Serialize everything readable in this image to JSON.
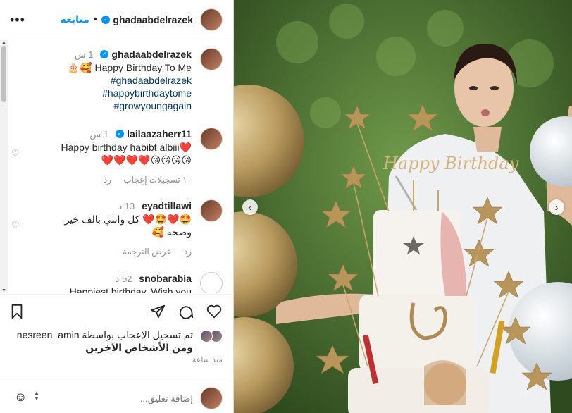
{
  "header": {
    "username": "ghadaabdelrazek",
    "follow": "متابعة",
    "more": "•••"
  },
  "caption": {
    "username": "ghadaabdelrazek",
    "time": "1 س",
    "text": "Happy Birthday To Me",
    "emojis": "🎂🥰",
    "tags": [
      "ghadaabdelrazek#",
      "#happybirthdaytome",
      "#growyoungagain"
    ]
  },
  "comments": [
    {
      "username": "lailaazaherr11",
      "time": "1 س",
      "line1": "Happy birthday habibt albiii",
      "line1_emoji": "❤️",
      "line2": "❤️❤️❤️❤️😘😘😘😘",
      "likes": "١٠ تسجيلات إعجاب",
      "reply": "رد"
    },
    {
      "username": "eyadtillawi",
      "time": "13 د",
      "line1": "🤩❤️🤩❤️ كل وانتي بالف خير",
      "line2": "وصحه 🥰",
      "translate": "عرض الترجمة",
      "reply": "رد"
    },
    {
      "username": "snobarabia",
      "time": "52 د",
      "line1": "Happiest birthday. Wish you"
    }
  ],
  "liked_by": {
    "line1": "تم تسجيل الإعجاب بواسطة nesreen_amin",
    "line2": "ومن الأشخاص الآخرين",
    "time": "منذ ساعة"
  },
  "add_comment": {
    "placeholder": "إضافة تعليق...",
    "emoji": "☺"
  },
  "photo": {
    "cake_topper": "Happy Birthday"
  },
  "colors": {
    "accent": "#0095f6",
    "text": "#262626",
    "muted": "#8e8e8e"
  }
}
